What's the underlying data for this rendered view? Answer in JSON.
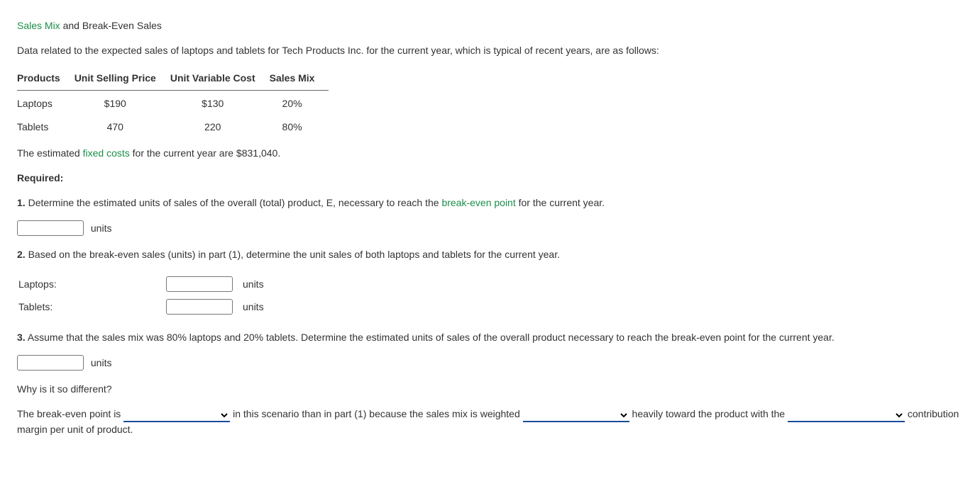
{
  "title": {
    "link": "Sales Mix",
    "rest": " and Break-Even Sales"
  },
  "intro": "Data related to the expected sales of laptops and tablets for Tech Products Inc. for the current year, which is typical of recent years, are as follows:",
  "table": {
    "headers": {
      "products": "Products",
      "price": "Unit Selling Price",
      "cost": "Unit Variable Cost",
      "mix": "Sales Mix"
    },
    "rows": [
      {
        "product": "Laptops",
        "price": "$190",
        "cost": "$130",
        "mix": "20%"
      },
      {
        "product": "Tablets",
        "price": "470",
        "cost": "220",
        "mix": "80%"
      }
    ]
  },
  "fixed": {
    "pre": "The estimated ",
    "link": "fixed costs",
    "post": " for the current year are $831,040."
  },
  "required_label": "Required:",
  "q1": {
    "num": "1.",
    "pre": " Determine the estimated units of sales of the overall (total) product, E, necessary to reach the ",
    "link": "break-even point",
    "post": " for the current year.",
    "units": "units"
  },
  "q2": {
    "num": "2.",
    "text": " Based on the break-even sales (units) in part (1), determine the unit sales of both laptops and tablets for the current year.",
    "rows": [
      {
        "label": "Laptops:",
        "units": "units"
      },
      {
        "label": "Tablets:",
        "units": "units"
      }
    ]
  },
  "q3": {
    "num": "3.",
    "text": " Assume that the sales mix was 80% laptops and 20% tablets. Determine the estimated units of sales of the overall product necessary to reach the break-even point for the current year.",
    "units": "units",
    "why": "Why is it so different?",
    "sentence": {
      "s1": "The break-even point is ",
      "s2": " in this scenario than in part (1) because the sales mix is weighted ",
      "s3": " heavily toward the product with the ",
      "s4": " contribution margin per unit of product."
    }
  }
}
